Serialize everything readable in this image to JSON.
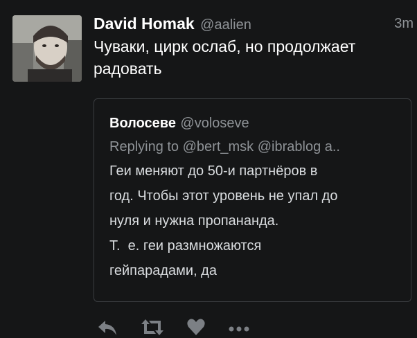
{
  "tweet": {
    "author_name": "David Homak",
    "handle": "@aalien",
    "time": "3m",
    "text_lines": [
      "Чуваки, цирк ослаб, но продолжает",
      "радовать"
    ]
  },
  "quote": {
    "author_name": "Волосеве",
    "handle": "@voloseve",
    "replying": "Replying to @bert_msk @ibrablog a..",
    "text_lines": [
      "Геи меняют до 50-и партнёров в",
      "год. Чтобы этот уровень не упал до",
      "нуля и нужна пропананда.",
      "Т.  е. геи размножаются",
      "гейпарадами, да"
    ]
  },
  "actions": {
    "reply_icon": "reply-icon",
    "retweet_icon": "retweet-icon",
    "like_icon": "heart-icon",
    "more_icon": "more-icon"
  },
  "colors": {
    "background": "#151617",
    "text": "#ffffff",
    "muted": "#8e9296",
    "border": "#3a3d40"
  }
}
